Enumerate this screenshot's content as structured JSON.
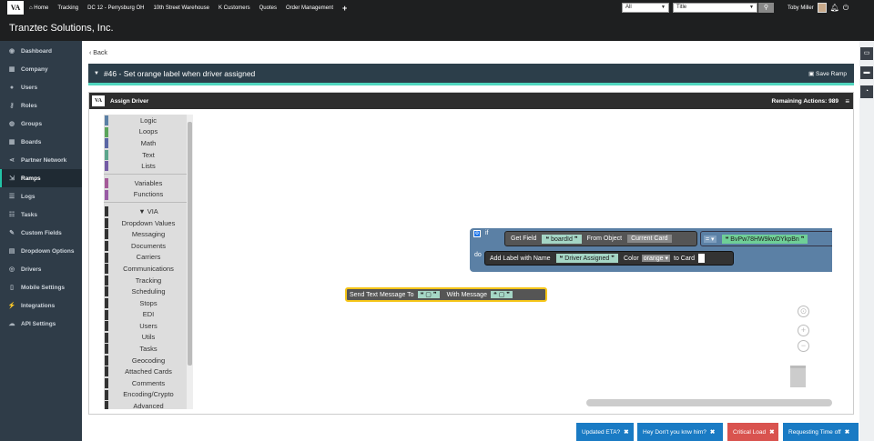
{
  "topbar": {
    "home": "Home",
    "nav": [
      "Tracking",
      "DC 12 - Perrysburg OH",
      "10th Street Warehouse",
      "K Customers",
      "Quotes",
      "Order Management"
    ],
    "add": "+",
    "filter_all": "All",
    "filter_title": "Title",
    "user": "Toby Miller"
  },
  "app_title": "Tranztec Solutions, Inc.",
  "sidebar": {
    "items": [
      {
        "icon": "palette-icon",
        "label": "Dashboard"
      },
      {
        "icon": "building-icon",
        "label": "Company"
      },
      {
        "icon": "user-icon",
        "label": "Users"
      },
      {
        "icon": "key-icon",
        "label": "Roles"
      },
      {
        "icon": "users-icon",
        "label": "Groups"
      },
      {
        "icon": "grid-icon",
        "label": "Boards"
      },
      {
        "icon": "share-icon",
        "label": "Partner Network"
      },
      {
        "icon": "ramp-icon",
        "label": "Ramps"
      },
      {
        "icon": "list-icon",
        "label": "Logs"
      },
      {
        "icon": "tasks-icon",
        "label": "Tasks"
      },
      {
        "icon": "edit-icon",
        "label": "Custom Fields"
      },
      {
        "icon": "dropdown-icon",
        "label": "Dropdown Options"
      },
      {
        "icon": "wheel-icon",
        "label": "Drivers"
      },
      {
        "icon": "mobile-icon",
        "label": "Mobile Settings"
      },
      {
        "icon": "plug-icon",
        "label": "Integrations"
      },
      {
        "icon": "cloud-icon",
        "label": "API Settings"
      }
    ],
    "active_index": 7
  },
  "back": "Back",
  "ramp": {
    "title": "#46 - Set orange label when driver assigned",
    "save": "Save Ramp"
  },
  "editor": {
    "header": "Assign Driver",
    "remaining": "Remaining Actions: 989"
  },
  "toolbox": [
    {
      "label": "Logic",
      "color": "#5b80a5"
    },
    {
      "label": "Loops",
      "color": "#5ba55b"
    },
    {
      "label": "Math",
      "color": "#5b67a5"
    },
    {
      "label": "Text",
      "color": "#5ba58c"
    },
    {
      "label": "Lists",
      "color": "#745ba5"
    },
    {
      "label": "",
      "color": ""
    },
    {
      "label": "Variables",
      "color": "#a55b99"
    },
    {
      "label": "Functions",
      "color": "#995ba5"
    },
    {
      "label": "",
      "color": ""
    },
    {
      "label": "▼ VIA",
      "color": "#333"
    },
    {
      "label": "Dropdown Values",
      "color": "#333"
    },
    {
      "label": "Messaging",
      "color": "#333"
    },
    {
      "label": "Documents",
      "color": "#333"
    },
    {
      "label": "Carriers",
      "color": "#333"
    },
    {
      "label": "Communications",
      "color": "#333"
    },
    {
      "label": "Tracking",
      "color": "#333"
    },
    {
      "label": "Scheduling",
      "color": "#333"
    },
    {
      "label": "Stops",
      "color": "#333"
    },
    {
      "label": "EDI",
      "color": "#333"
    },
    {
      "label": "Users",
      "color": "#333"
    },
    {
      "label": "Utils",
      "color": "#333"
    },
    {
      "label": "Tasks",
      "color": "#333"
    },
    {
      "label": "Geocoding",
      "color": "#333"
    },
    {
      "label": "Attached Cards",
      "color": "#333"
    },
    {
      "label": "Comments",
      "color": "#333"
    },
    {
      "label": "Encoding/Crypto",
      "color": "#333"
    },
    {
      "label": "Advanced",
      "color": "#333"
    }
  ],
  "blocks": {
    "if": "if",
    "do": "do",
    "get_field": "Get Field",
    "field": "boardId",
    "from_object": "From Object",
    "current_card": "Current Card",
    "eq": "=",
    "value": "BvPw78HW9kwDYkpBn",
    "add_label": "Add Label with Name",
    "label_name": "Driver Assigned",
    "color_label": "Color",
    "color_value": "orange",
    "to_card": "to Card",
    "send_text": "Send Text Message To",
    "with_message": "With Message"
  },
  "tags": [
    {
      "label": "Updated ETA?",
      "color": "#1a7bc4"
    },
    {
      "label": "Hey Don't you knw him?",
      "color": "#1a7bc4"
    },
    {
      "label": "Critical Load",
      "color": "#d9534f"
    },
    {
      "label": "Requesting Time off",
      "color": "#1a7bc4"
    }
  ]
}
